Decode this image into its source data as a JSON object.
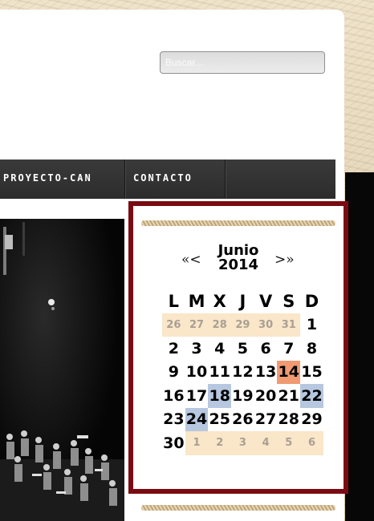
{
  "search": {
    "placeholder": "Buscar..."
  },
  "nav": {
    "items": [
      {
        "label": "PROYECTO-CAN"
      },
      {
        "label": "CONTACTO"
      }
    ]
  },
  "calendar": {
    "prev": "«<",
    "next": ">»",
    "month": "Junio",
    "year": "2014",
    "weekdays": [
      "L",
      "M",
      "X",
      "J",
      "V",
      "S",
      "D"
    ],
    "weeks": [
      [
        {
          "d": "26",
          "type": "other"
        },
        {
          "d": "27",
          "type": "other"
        },
        {
          "d": "28",
          "type": "other"
        },
        {
          "d": "29",
          "type": "other"
        },
        {
          "d": "30",
          "type": "other"
        },
        {
          "d": "31",
          "type": "other"
        },
        {
          "d": "1",
          "type": "current"
        }
      ],
      [
        {
          "d": "2",
          "type": "current"
        },
        {
          "d": "3",
          "type": "current"
        },
        {
          "d": "4",
          "type": "current"
        },
        {
          "d": "5",
          "type": "current"
        },
        {
          "d": "6",
          "type": "current"
        },
        {
          "d": "7",
          "type": "current"
        },
        {
          "d": "8",
          "type": "current"
        }
      ],
      [
        {
          "d": "9",
          "type": "current"
        },
        {
          "d": "10",
          "type": "current"
        },
        {
          "d": "11",
          "type": "current"
        },
        {
          "d": "12",
          "type": "current"
        },
        {
          "d": "13",
          "type": "current"
        },
        {
          "d": "14",
          "type": "today"
        },
        {
          "d": "15",
          "type": "current"
        }
      ],
      [
        {
          "d": "16",
          "type": "current"
        },
        {
          "d": "17",
          "type": "current"
        },
        {
          "d": "18",
          "type": "event"
        },
        {
          "d": "19",
          "type": "current"
        },
        {
          "d": "20",
          "type": "current"
        },
        {
          "d": "21",
          "type": "current"
        },
        {
          "d": "22",
          "type": "event"
        }
      ],
      [
        {
          "d": "23",
          "type": "current"
        },
        {
          "d": "24",
          "type": "event"
        },
        {
          "d": "25",
          "type": "current"
        },
        {
          "d": "26",
          "type": "current"
        },
        {
          "d": "27",
          "type": "current"
        },
        {
          "d": "28",
          "type": "current"
        },
        {
          "d": "29",
          "type": "current"
        }
      ],
      [
        {
          "d": "30",
          "type": "current"
        },
        {
          "d": "1",
          "type": "other"
        },
        {
          "d": "2",
          "type": "other"
        },
        {
          "d": "3",
          "type": "other"
        },
        {
          "d": "4",
          "type": "other"
        },
        {
          "d": "5",
          "type": "other"
        },
        {
          "d": "6",
          "type": "other"
        }
      ]
    ]
  },
  "colors": {
    "frame": "#7b0b12",
    "today": "#ef9a72",
    "event": "#b7c7e0",
    "other_month": "#fae6c8",
    "navbar": "#333333"
  }
}
